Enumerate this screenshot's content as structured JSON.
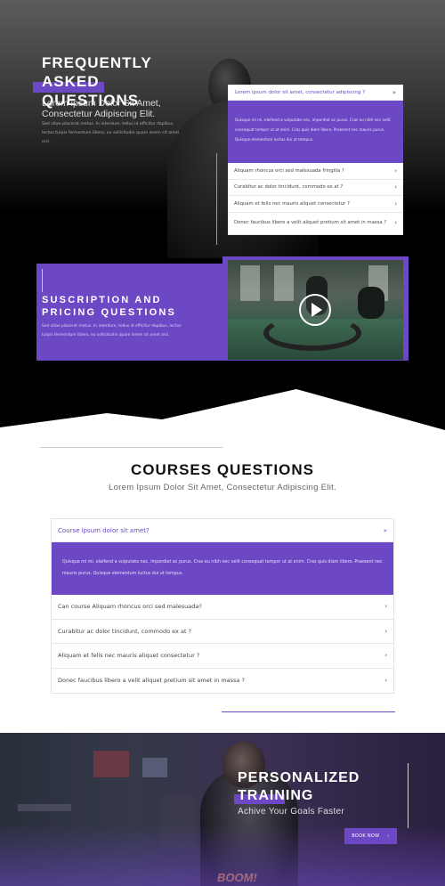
{
  "faq_section": {
    "title": "FREQUENTLY ASKED QUESTIONS",
    "subtitle": "Lorem ipsum Dolor Sit Amet, Consectetur Adipiscing Elit.",
    "body": "Sed vitae placerat metus. In interdum, tellus id efficitur dapibus, lectus turpis fermentum libero, eu sollicitudin quam lorem sit amet orci.",
    "accordion": {
      "open_question": "Lorem ipsum dolor sit amet, consectetur adipiscing ?",
      "open_answer": "Quisque mi mi, eleifend a vulputate nec, imperdiet ac purus. Cras eu nibh nec velit consequat tempor ut at enim. Cras quis diam libero. Praesent nec mauris purus. Quisque elementum luctus dui ut tempus.",
      "questions": [
        "Aliquam rhoncus orci sed malesuada fringilla ?",
        "Curabitur ac dolor tincidunt, commodo ex at ?",
        "Aliquam et felis nec mauris aliquet consectetur ?",
        "Donec faucibus libero a velit aliquet pretium sit amet in massa ?"
      ]
    }
  },
  "subscription": {
    "title": "SUSCRIPTION AND PRICING QUESTIONS",
    "body": "Sed vitae placerat metus. In interdum, tellus id efficitur dapibus, lectus turpis fermentum libero, eu sollicitudin quam lorem sit amet orci."
  },
  "courses": {
    "title": "COURSES QUESTIONS",
    "subtitle": "Lorem Ipsum Dolor Sit Amet, Consectetur Adipiscing Elit.",
    "accordion": {
      "open_question": "Course ipsum dolor sit amet?",
      "open_answer": "Quisque mi mi, eleifend a vulputate nec, imperdiet ac purus. Cras eu nibh nec velit consequat tempor ut at enim. Cras quis diam libero. Praesent nec mauris purus. Quisque elementum luctus dui ut tempus.",
      "questions": [
        "Can course Aliquam rhoncus orci sed malesuada?",
        "Curabitur ac dolor tincidunt, commodo ex at ?",
        "Aliquam et felis nec mauris aliquet consectetur ?",
        "Donec faucibus libero a velit aliquet pretium sit amet in massa ?"
      ]
    }
  },
  "training": {
    "title": "PERSONALIZED TRAINING",
    "subtitle": "Achive Your Goals Faster",
    "button_label": "BOOK NOW",
    "button_icon": "chevron-right-icon"
  },
  "icons": {
    "open_chevron": "chevron-double-down-icon",
    "closed_chevron": "chevron-right-icon",
    "play": "play-icon"
  },
  "colors": {
    "accent": "#6c48c5",
    "dark": "#000000",
    "light": "#ffffff"
  }
}
